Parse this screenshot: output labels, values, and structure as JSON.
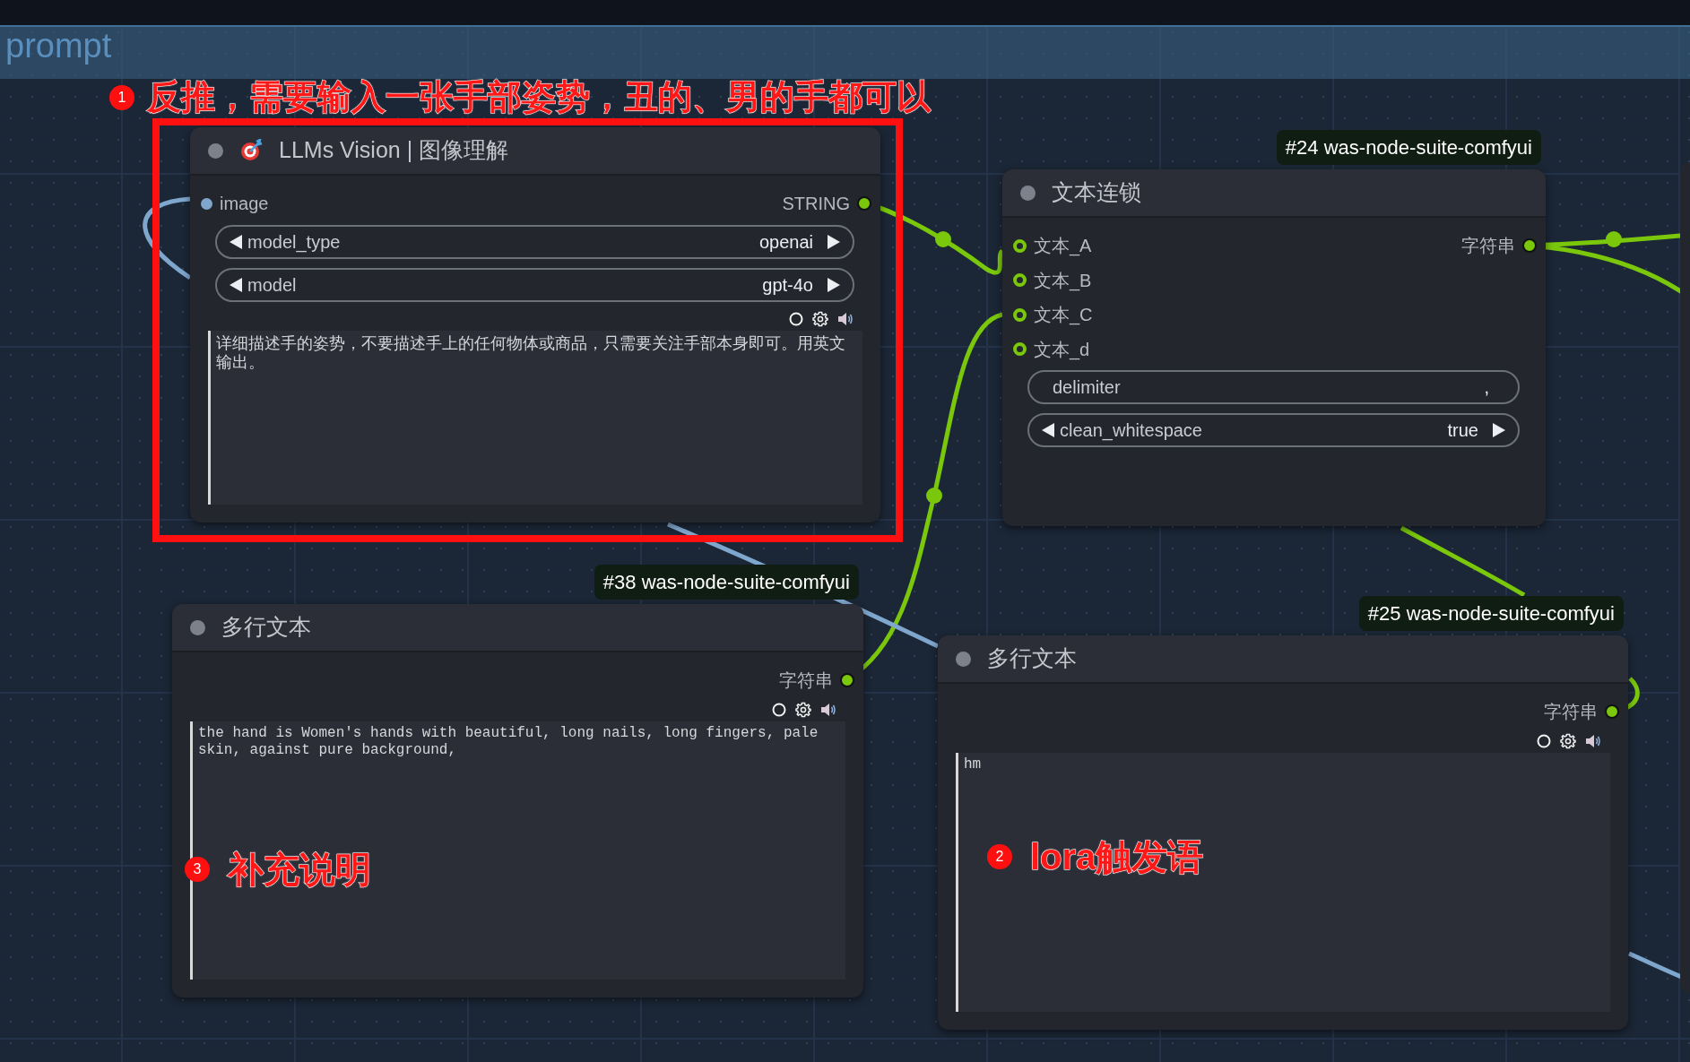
{
  "group": {
    "title": "prompt"
  },
  "annotations": [
    {
      "number": "1",
      "text": "反推，需要输入一张手部姿势，丑的、男的手都可以"
    },
    {
      "number": "3",
      "text": "补充说明"
    },
    {
      "number": "2",
      "text": "lora触发语"
    }
  ],
  "nodes": [
    {
      "title": "LLMs Vision | 图像理解",
      "inputs": [
        {
          "label": "image",
          "kind": "image"
        }
      ],
      "outputs": [
        {
          "label": "STRING"
        }
      ],
      "widgets": [
        {
          "kind": "combo",
          "name": "model_type",
          "value": "openai"
        },
        {
          "kind": "combo",
          "name": "model",
          "value": "gpt-4o"
        }
      ],
      "textarea": {
        "value": "详细描述手的姿势，不要描述手上的任何物体或商品，只需要关注手部本身即可。用英文输出。"
      }
    },
    {
      "badge": "#24 was-node-suite-comfyui",
      "title": "文本连锁",
      "inputs": [
        {
          "label": "文本_A",
          "kind": "string"
        },
        {
          "label": "文本_B",
          "kind": "string"
        },
        {
          "label": "文本_C",
          "kind": "string"
        },
        {
          "label": "文本_d",
          "kind": "string"
        }
      ],
      "outputs": [
        {
          "label": "字符串"
        }
      ],
      "widgets": [
        {
          "kind": "text",
          "name": "delimiter",
          "value": ","
        },
        {
          "kind": "combo",
          "name": "clean_whitespace",
          "value": "true"
        }
      ]
    },
    {
      "badge": "#38 was-node-suite-comfyui",
      "title": "多行文本",
      "outputs": [
        {
          "label": "字符串"
        }
      ],
      "textarea": {
        "value": "the hand is Women's hands with beautiful, long nails, long fingers, pale skin, against pure background,"
      }
    },
    {
      "badge": "#25 was-node-suite-comfyui",
      "title": "多行文本",
      "outputs": [
        {
          "label": "字符串"
        }
      ],
      "textarea": {
        "value": "hm"
      }
    }
  ]
}
